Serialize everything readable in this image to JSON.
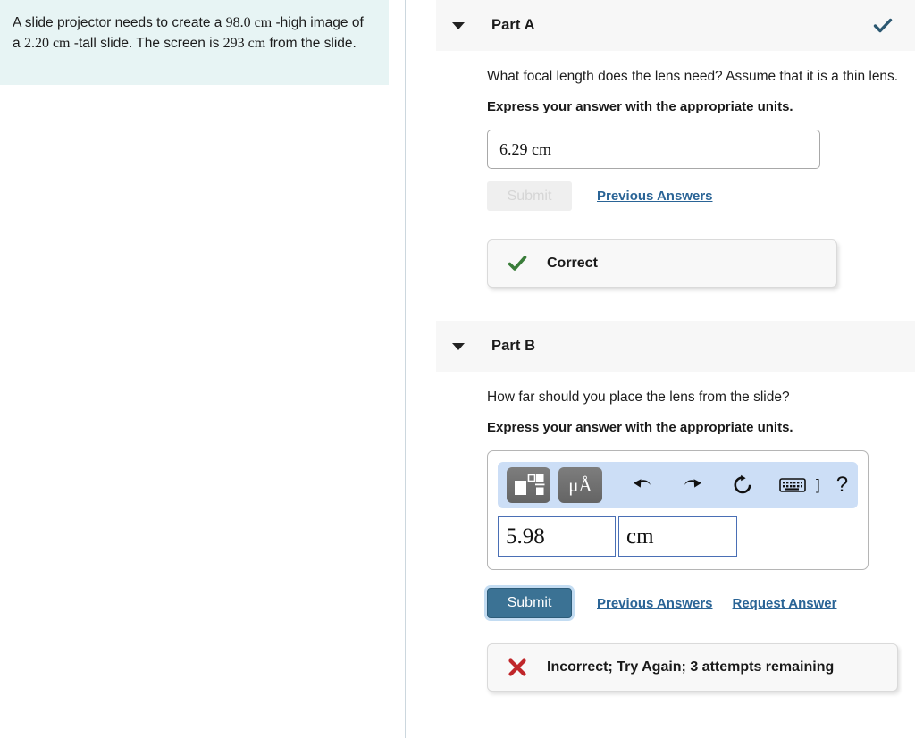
{
  "problem": {
    "segments": [
      {
        "text": "A slide projector needs to create a ",
        "style": "normal"
      },
      {
        "text": "98.0 cm",
        "style": "math"
      },
      {
        "text": " -high image of a ",
        "style": "normal"
      },
      {
        "text": "2.20 cm",
        "style": "math"
      },
      {
        "text": " -tall slide. The screen is ",
        "style": "normal"
      },
      {
        "text": "293 cm",
        "style": "math"
      },
      {
        "text": " from the slide.",
        "style": "normal"
      }
    ],
    "full_text": "A slide projector needs to create a 98.0 cm -high image of a 2.20 cm -tall slide. The screen is 293 cm from the slide."
  },
  "part_a": {
    "title": "Part A",
    "caret_icon": "caret-down-icon",
    "status_icon": "check-icon",
    "status_color": "#2c5871",
    "question": "What focal length does the lens need? Assume that it is a thin lens.",
    "instruction": "Express your answer with the appropriate units.",
    "answer_value": "6.29 cm",
    "submit_label": "Submit",
    "submit_enabled": false,
    "previous_answers_label": "Previous Answers",
    "feedback": {
      "icon": "check-icon",
      "icon_color": "#3a7d3a",
      "label": "Correct"
    }
  },
  "part_b": {
    "title": "Part B",
    "caret_icon": "caret-down-icon",
    "question": "How far should you place the lens from the slide?",
    "instruction": "Express your answer with the appropriate units.",
    "toolbar": {
      "template_button": "math-template-icon",
      "units_button": "μÅ",
      "undo_button": "undo-icon",
      "redo_button": "redo-icon",
      "reset_button": "reset-icon",
      "keyboard_button": "keyboard-icon",
      "keyboard_bracket": "]",
      "help_button": "?"
    },
    "answer_value": "5.98",
    "answer_unit": "cm",
    "submit_label": "Submit",
    "submit_enabled": true,
    "previous_answers_label": "Previous Answers",
    "request_answer_label": "Request Answer",
    "feedback": {
      "icon": "cross-icon",
      "icon_color": "#c0262a",
      "label": "Incorrect; Try Again; 3 attempts remaining"
    }
  },
  "colors": {
    "problem_background": "#e7f4f4",
    "part_header_background": "#f7f7f7",
    "link": "#2a6496",
    "submit_active": "#3b7294",
    "toolbar_background": "#ccdef6",
    "math_box_border": "#4a6fb5"
  }
}
